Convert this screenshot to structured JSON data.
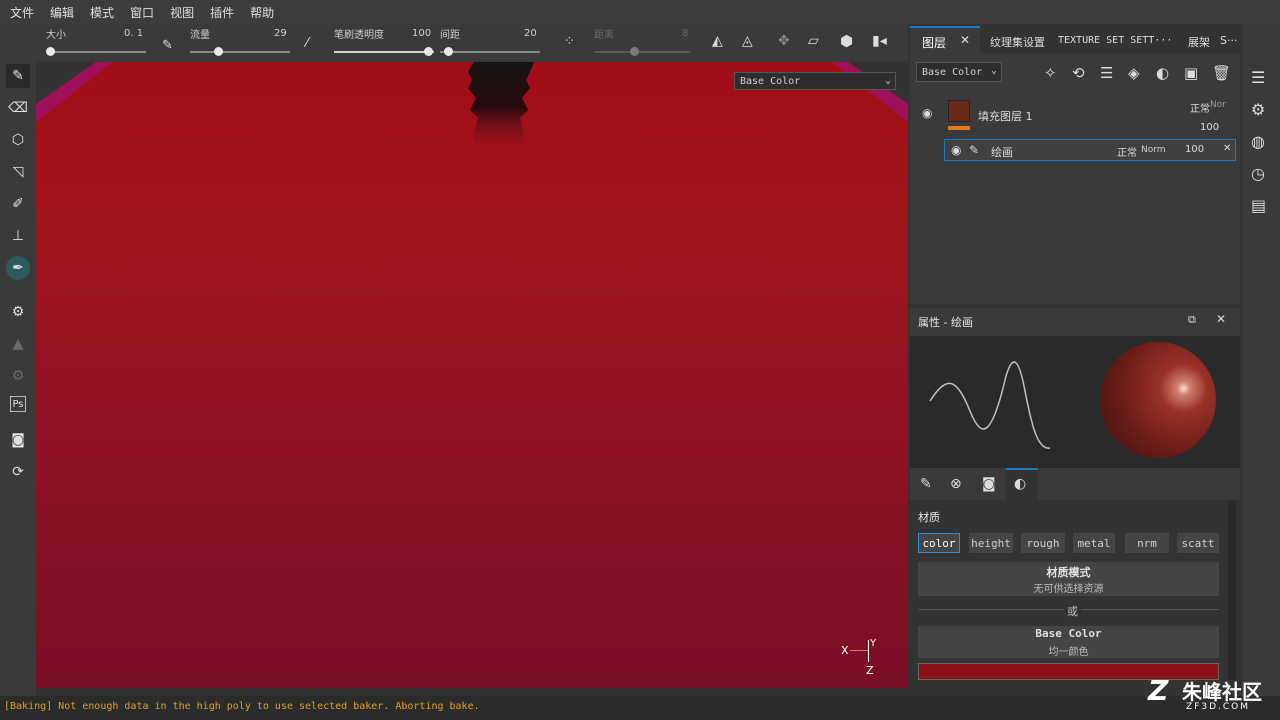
{
  "menu": [
    "文件",
    "编辑",
    "模式",
    "窗口",
    "视图",
    "插件",
    "帮助"
  ],
  "toolbar": {
    "size_label": "大小",
    "size_value": "0. 1",
    "flow_label": "流量",
    "flow_value": "29",
    "opacity_label": "笔刷透明度",
    "opacity_value": "100",
    "spacing_label": "间距",
    "spacing_value": "20",
    "distance_label": "距离",
    "distance_value": "8"
  },
  "viewport": {
    "channel_dropdown": "Base Color",
    "axis_x": "X",
    "axis_y": "Y",
    "axis_z": "Z"
  },
  "layers": {
    "tabs": [
      "图层",
      "纹理集设置",
      "TEXTURE SET SETT···",
      "展架",
      "S···"
    ],
    "channel_dropdown": "Base Color",
    "items": [
      {
        "name": "填充图层 1",
        "blend": "正常",
        "blend2": "Nor",
        "opacity": "100"
      },
      {
        "name": "绘画",
        "blend": "正常",
        "blend2": "Norm",
        "opacity": "100"
      }
    ]
  },
  "properties": {
    "title": "属性 - 绘画",
    "section": "材质",
    "channels": [
      "color",
      "height",
      "rough",
      "metal",
      "nrm",
      "scatt"
    ],
    "material_mode_label": "材质模式",
    "material_mode_value": "无可供选择资源",
    "or_label": "或",
    "base_color_label": "Base Color",
    "base_color_value": "均一颜色",
    "swatch_color": "#8b1116"
  },
  "status": {
    "message": "[Baking] Not enough data in the high poly to use selected baker. Aborting bake."
  },
  "watermark": {
    "text": "朱峰社区",
    "sub": "ZF3D.COM"
  }
}
